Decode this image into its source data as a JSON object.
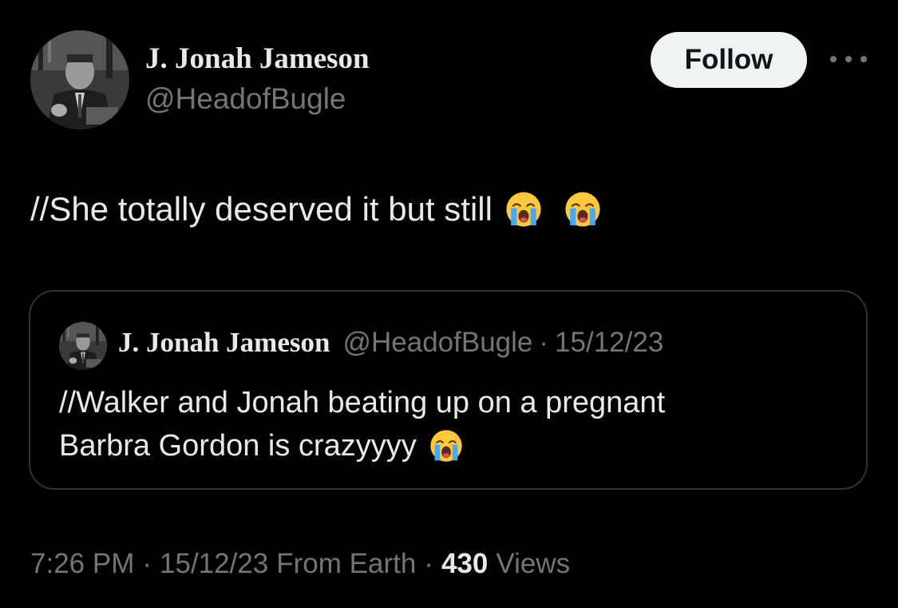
{
  "author": {
    "name": "J. Jonah Jameson",
    "handle": "@HeadofBugle"
  },
  "actions": {
    "follow_label": "Follow",
    "more_icon": "more-horizontal-icon"
  },
  "tweet": {
    "text": "//She totally deserved it but still",
    "emojis": [
      "loudly-crying-face-icon",
      "loudly-crying-face-icon"
    ]
  },
  "quote": {
    "name": "J. Jonah Jameson",
    "handle": "@HeadofBugle",
    "separator": "·",
    "date": "15/12/23",
    "line1": "//Walker and Jonah beating up on a pregnant",
    "line2": "Barbra Gordon is crazyyyy",
    "emoji": "loudly-crying-face-icon"
  },
  "meta": {
    "time": "7:26 PM",
    "separator": "·",
    "date": "15/12/23",
    "location": "From Earth",
    "views_count": "430",
    "views_label": "Views"
  },
  "colors": {
    "background": "#000000",
    "primary_text": "#e7e9ea",
    "secondary_text": "#71767b",
    "border": "#2f3336",
    "follow_bg": "#eff3f4",
    "emoji_face": "#ffc83d"
  }
}
